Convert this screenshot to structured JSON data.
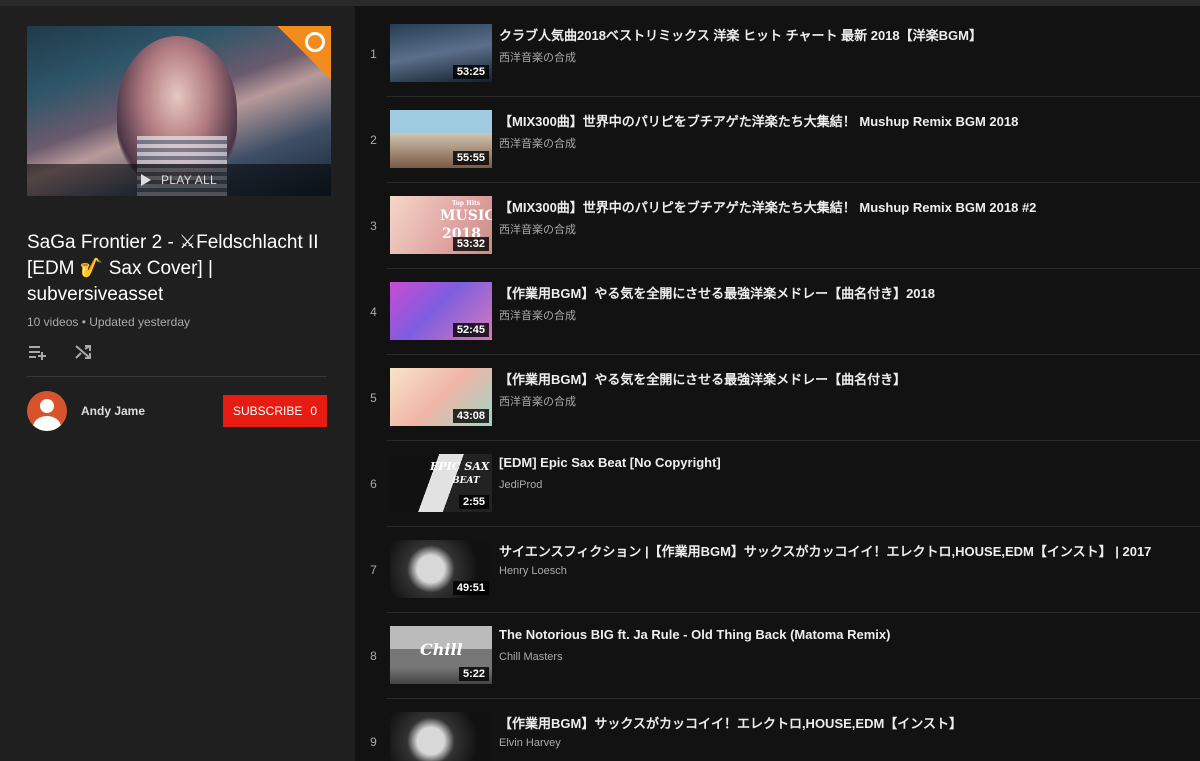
{
  "playlist": {
    "title": "SaGa Frontier 2 - ⚔Feldschlacht II [EDM 🎷 Sax Cover] | subversiveasset",
    "video_count": "10 videos",
    "updated": "Updated yesterday",
    "play_all_label": "PLAY ALL",
    "owner_name": "Andy Jame",
    "subscribe_label": "SUBSCRIBE",
    "subscriber_count": "0"
  },
  "videos": [
    {
      "index": "1",
      "title": "クラブ人気曲2018ベストリミックス 洋楽 ヒット チャート 最新 2018【洋楽BGM】",
      "channel": "西洋音楽の合成",
      "duration": "53:25"
    },
    {
      "index": "2",
      "title": "【MIX300曲】世界中のパリピをブチアゲた洋楽たち大集結！ Mushup Remix BGM 2018",
      "channel": "西洋音楽の合成",
      "duration": "55:55"
    },
    {
      "index": "3",
      "title": "【MIX300曲】世界中のパリピをブチアゲた洋楽たち大集結！ Mushup Remix BGM 2018 #2",
      "channel": "西洋音楽の合成",
      "duration": "53:32"
    },
    {
      "index": "4",
      "title": "【作業用BGM】やる気を全開にさせる最強洋楽メドレー【曲名付き】2018",
      "channel": "西洋音楽の合成",
      "duration": "52:45"
    },
    {
      "index": "5",
      "title": "【作業用BGM】やる気を全開にさせる最強洋楽メドレー【曲名付き】",
      "channel": "西洋音楽の合成",
      "duration": "43:08"
    },
    {
      "index": "6",
      "title": "[EDM] Epic Sax Beat [No Copyright]",
      "channel": "JediProd",
      "duration": "2:55"
    },
    {
      "index": "7",
      "title": "サイエンスフィクション |【作業用BGM】サックスがカッコイイ！エレクトロ,HOUSE,EDM【インスト】 | 2017",
      "channel": "Henry Loesch",
      "duration": "49:51"
    },
    {
      "index": "8",
      "title": "The Notorious BIG ft. Ja Rule - Old Thing Back (Matoma Remix)",
      "channel": "Chill Masters",
      "duration": "5:22"
    },
    {
      "index": "9",
      "title": "【作業用BGM】サックスがカッコイイ！エレクトロ,HOUSE,EDM【インスト】",
      "channel": "Elvin Harvey",
      "duration": ""
    }
  ],
  "thumb_labels": {
    "t3_small": "Top Hits",
    "t3_main": "MUSIC",
    "t3_year": "2018",
    "t6_main": "EPIC SAX",
    "t6_sub": "BEAT",
    "t8_main": "Chill"
  },
  "colors": {
    "accent": "#e61c12",
    "badge": "#f28c1e",
    "avatar": "#d6532b"
  }
}
